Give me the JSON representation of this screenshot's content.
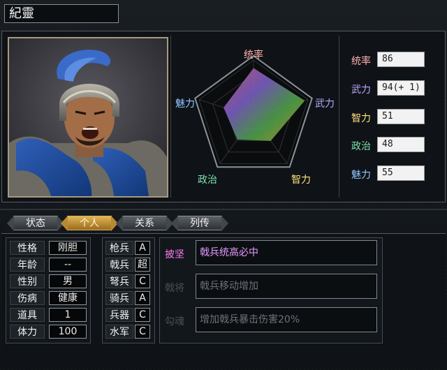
{
  "officer": {
    "name": "紀靈"
  },
  "radar": {
    "labels": {
      "top": "统率",
      "right": "武力",
      "bottom_right": "智力",
      "bottom_left": "政治",
      "left": "魅力"
    },
    "values": {
      "leadership": 86,
      "war": 94,
      "intelligence": 51,
      "politics": 48,
      "charm": 55
    },
    "max": 100
  },
  "stats": [
    {
      "label": "统率",
      "value": "86",
      "color": "#ffb0b0"
    },
    {
      "label": "武力",
      "value": "94(+ 1)",
      "color": "#b9a6ff"
    },
    {
      "label": "智力",
      "value": "51",
      "color": "#ffe07a"
    },
    {
      "label": "政治",
      "value": "48",
      "color": "#7fe0b0"
    },
    {
      "label": "魅力",
      "value": "55",
      "color": "#8fc8ff"
    }
  ],
  "tabs": [
    {
      "label": "状态",
      "active": false
    },
    {
      "label": "个人",
      "active": true
    },
    {
      "label": "关系",
      "active": false
    },
    {
      "label": "列传",
      "active": false
    }
  ],
  "personal": [
    {
      "label": "性格",
      "value": "刚胆"
    },
    {
      "label": "年龄",
      "value": "--"
    },
    {
      "label": "性别",
      "value": "男"
    },
    {
      "label": "伤病",
      "value": "健康"
    },
    {
      "label": "道具",
      "value": "1"
    },
    {
      "label": "体力",
      "value": "100"
    }
  ],
  "aptitudes": [
    {
      "label": "枪兵",
      "value": "A"
    },
    {
      "label": "戟兵",
      "value": "超"
    },
    {
      "label": "弩兵",
      "value": "C"
    },
    {
      "label": "骑兵",
      "value": "A"
    },
    {
      "label": "兵器",
      "value": "C"
    },
    {
      "label": "水军",
      "value": "C"
    }
  ],
  "skills": [
    {
      "label": "披坚",
      "desc": "戟兵统高必中",
      "active": true,
      "label_color": "#ff7cf0",
      "desc_color": "#e59bff"
    },
    {
      "label": "戟将",
      "desc": "戟兵移动增加",
      "active": false,
      "label_color": "#4a4f55",
      "desc_color": "#6d737a"
    },
    {
      "label": "勾魂",
      "desc": "增加戟兵暴击伤害20%",
      "active": false,
      "label_color": "#4a4f55",
      "desc_color": "#6d737a"
    }
  ]
}
